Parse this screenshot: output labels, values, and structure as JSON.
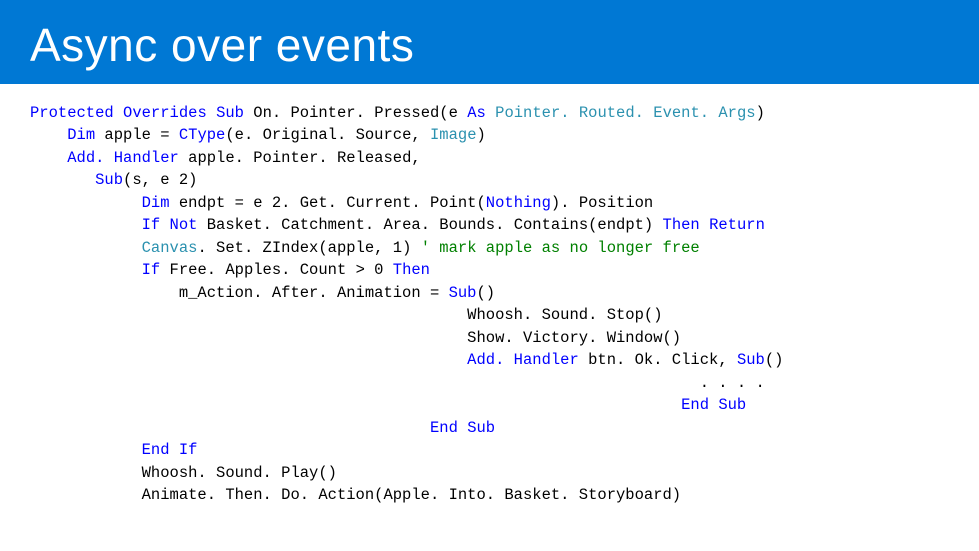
{
  "header": {
    "title": "Async over events"
  },
  "code": {
    "l01a": "Protected",
    "l01b": "Overrides",
    "l01c": "Sub",
    "l01d": " On. Pointer. Pressed(e ",
    "l01e": "As",
    "l01f": " ",
    "l01g": "Pointer. Routed. Event. Args",
    "l01h": ")",
    "l02a": "    ",
    "l02b": "Dim",
    "l02c": " apple = ",
    "l02d": "CType",
    "l02e": "(e. Original. Source, ",
    "l02f": "Image",
    "l02g": ")",
    "l03a": "    ",
    "l03b": "Add. Handler",
    "l03c": " apple. Pointer. Released,",
    "l04a": "       ",
    "l04b": "Sub",
    "l04c": "(s, e 2)",
    "l05a": "            ",
    "l05b": "Dim",
    "l05c": " endpt = e 2. Get. Current. Point(",
    "l05d": "Nothing",
    "l05e": "). Position",
    "l06a": "            ",
    "l06b": "If",
    "l06c": " ",
    "l06d": "Not",
    "l06e": " Basket. Catchment. Area. Bounds. Contains(endpt) ",
    "l06f": "Then",
    "l06g": " ",
    "l06h": "Return",
    "l07a": "            ",
    "l07b": "Canvas",
    "l07c": ". Set. ZIndex(apple, 1) ",
    "l07d": "' mark apple as no longer free",
    "l08a": "            ",
    "l08b": "If",
    "l08c": " Free. Apples. Count > 0 ",
    "l08d": "Then",
    "l09a": "                m_Action. After. Animation = ",
    "l09b": "Sub",
    "l09c": "()",
    "l10a": "                                               Whoosh. Sound. Stop()",
    "l11a": "                                               Show. Victory. Window()",
    "l12a": "                                               ",
    "l12b": "Add. Handler",
    "l12c": " btn. Ok. Click, ",
    "l12d": "Sub",
    "l12e": "()",
    "l13a": "                                                                        . . . .",
    "l14a": "                                                                      ",
    "l14b": "End",
    "l14c": " ",
    "l14d": "Sub",
    "l15a": "                                           ",
    "l15b": "End",
    "l15c": " ",
    "l15d": "Sub",
    "l16a": "            ",
    "l16b": "End",
    "l16c": " ",
    "l16d": "If",
    "l17a": "            Whoosh. Sound. Play()",
    "l18a": "            Animate. Then. Do. Action(Apple. Into. Basket. Storyboard)"
  }
}
